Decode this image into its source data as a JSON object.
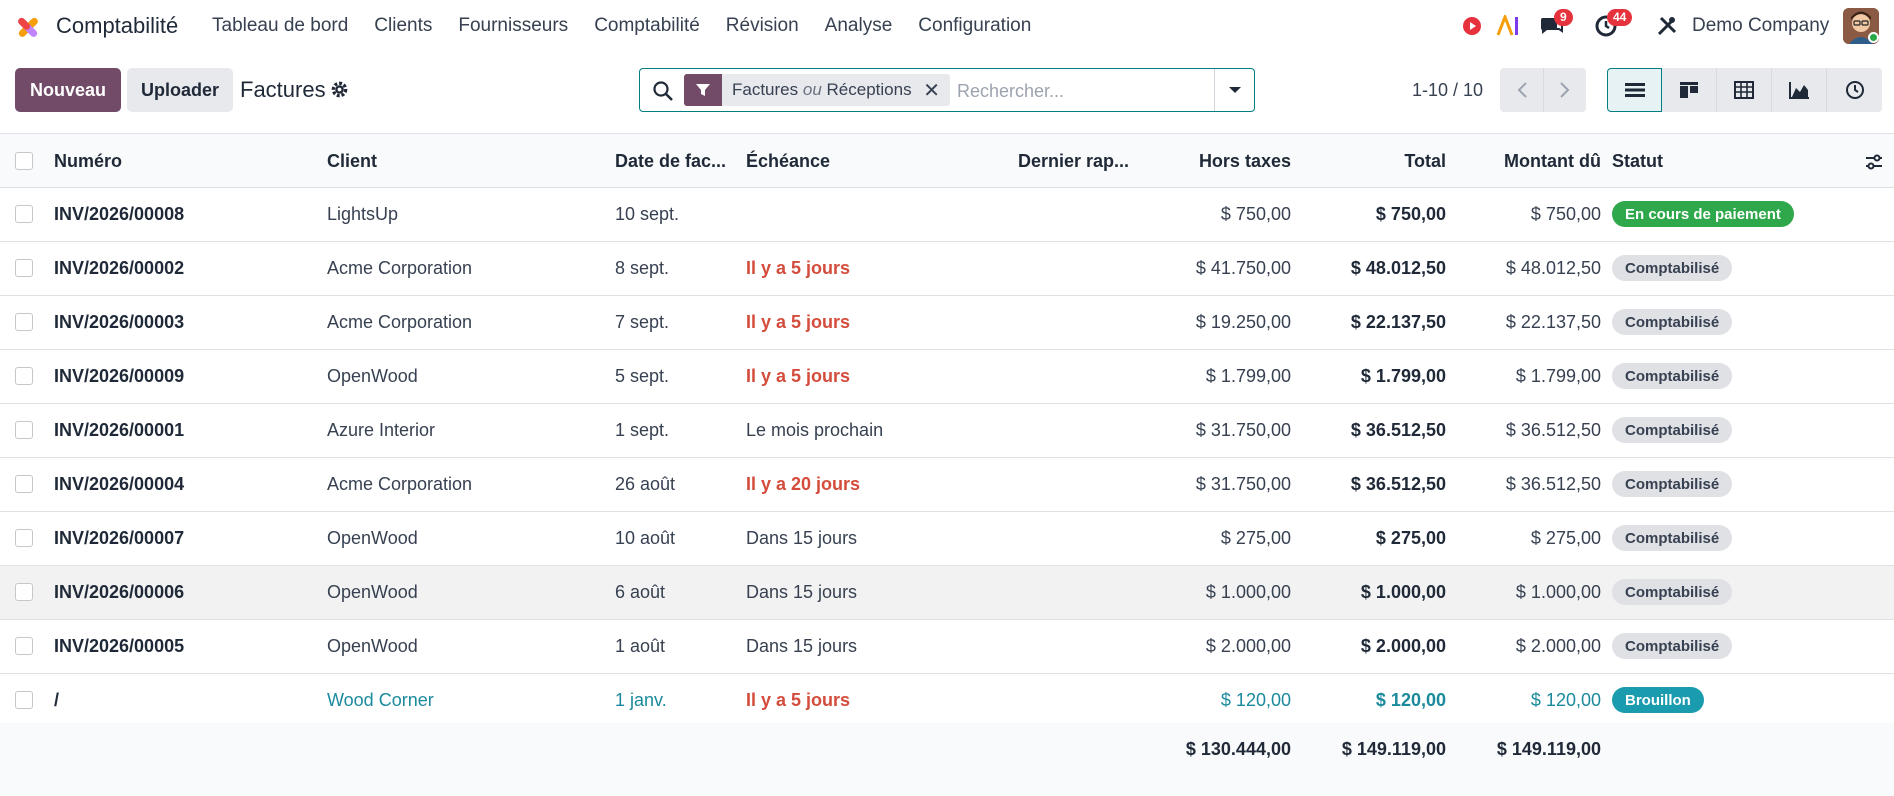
{
  "app": {
    "name": "Comptabilité",
    "menu": [
      "Tableau de bord",
      "Clients",
      "Fournisseurs",
      "Comptabilité",
      "Révision",
      "Analyse",
      "Configuration"
    ],
    "messages_count": "9",
    "activities_count": "44",
    "company": "Demo Company"
  },
  "control": {
    "new_label": "Nouveau",
    "upload_label": "Uploader",
    "breadcrumb": "Factures",
    "facet_part1": "Factures",
    "facet_or": "ou",
    "facet_part2": "Réceptions",
    "search_placeholder": "Rechercher...",
    "pager": "1-10 / 10"
  },
  "table": {
    "headers": {
      "number": "Numéro",
      "client": "Client",
      "date": "Date de fac...",
      "due": "Échéance",
      "reminder": "Dernier rap...",
      "untaxed": "Hors taxes",
      "total": "Total",
      "amount_due": "Montant dû",
      "status": "Statut"
    },
    "rows": [
      {
        "number": "INV/2026/00008",
        "client": "LightsUp",
        "date": "10 sept.",
        "due": "",
        "untaxed": "$ 750,00",
        "total": "$ 750,00",
        "amount_due": "$ 750,00",
        "status": "En cours de paiement"
      },
      {
        "number": "INV/2026/00002",
        "client": "Acme Corporation",
        "date": "8 sept.",
        "due": "Il y a 5 jours",
        "untaxed": "$ 41.750,00",
        "total": "$ 48.012,50",
        "amount_due": "$ 48.012,50",
        "status": "Comptabilisé"
      },
      {
        "number": "INV/2026/00003",
        "client": "Acme Corporation",
        "date": "7 sept.",
        "due": "Il y a 5 jours",
        "untaxed": "$ 19.250,00",
        "total": "$ 22.137,50",
        "amount_due": "$ 22.137,50",
        "status": "Comptabilisé"
      },
      {
        "number": "INV/2026/00009",
        "client": "OpenWood",
        "date": "5 sept.",
        "due": "Il y a 5 jours",
        "untaxed": "$ 1.799,00",
        "total": "$ 1.799,00",
        "amount_due": "$ 1.799,00",
        "status": "Comptabilisé"
      },
      {
        "number": "INV/2026/00001",
        "client": "Azure Interior",
        "date": "1 sept.",
        "due": "Le mois prochain",
        "untaxed": "$ 31.750,00",
        "total": "$ 36.512,50",
        "amount_due": "$ 36.512,50",
        "status": "Comptabilisé"
      },
      {
        "number": "INV/2026/00004",
        "client": "Acme Corporation",
        "date": "26 août",
        "due": "Il y a 20 jours",
        "untaxed": "$ 31.750,00",
        "total": "$ 36.512,50",
        "amount_due": "$ 36.512,50",
        "status": "Comptabilisé"
      },
      {
        "number": "INV/2026/00007",
        "client": "OpenWood",
        "date": "10 août",
        "due": "Dans 15 jours",
        "untaxed": "$ 275,00",
        "total": "$ 275,00",
        "amount_due": "$ 275,00",
        "status": "Comptabilisé"
      },
      {
        "number": "INV/2026/00006",
        "client": "OpenWood",
        "date": "6 août",
        "due": "Dans 15 jours",
        "untaxed": "$ 1.000,00",
        "total": "$ 1.000,00",
        "amount_due": "$ 1.000,00",
        "status": "Comptabilisé"
      },
      {
        "number": "INV/2026/00005",
        "client": "OpenWood",
        "date": "1 août",
        "due": "Dans 15 jours",
        "untaxed": "$ 2.000,00",
        "total": "$ 2.000,00",
        "amount_due": "$ 2.000,00",
        "status": "Comptabilisé"
      },
      {
        "number": "/",
        "client": "Wood Corner",
        "date": "1 janv.",
        "due": "Il y a 5 jours",
        "untaxed": "$ 120,00",
        "total": "$ 120,00",
        "amount_due": "$ 120,00",
        "status": "Brouillon"
      }
    ],
    "footer": {
      "untaxed": "$ 130.444,00",
      "total": "$ 149.119,00",
      "amount_due": "$ 149.119,00"
    }
  },
  "colors": {
    "brand": "#714b67",
    "accent": "#017e84",
    "late": "#d44c3b",
    "paying": "#2ea84a",
    "draft": "#1b9cae"
  }
}
